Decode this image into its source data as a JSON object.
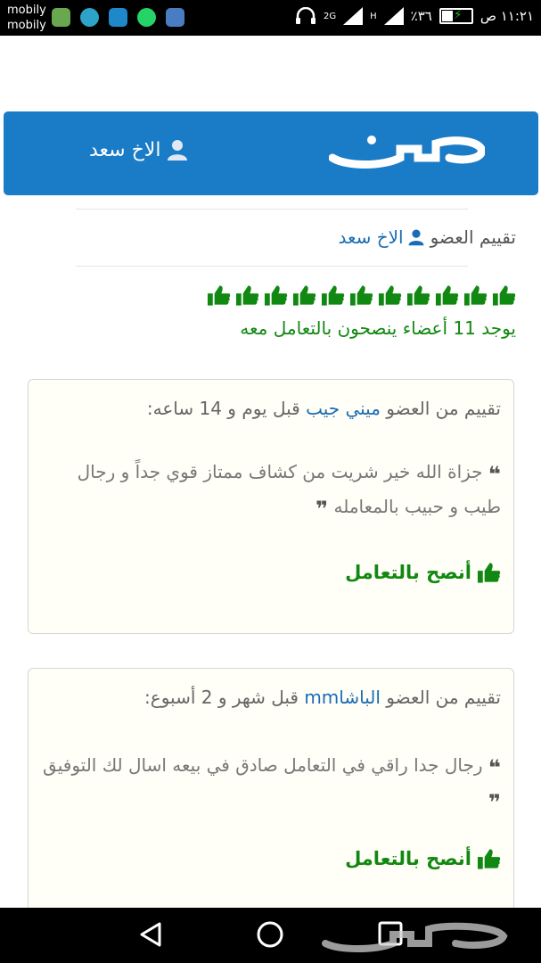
{
  "status_bar": {
    "carrier_line1": "mobily",
    "carrier_line2": "mobily",
    "network": "2G",
    "network2": "H",
    "battery_percent": "٪٣٦",
    "time": "١١:٢١ ص"
  },
  "header": {
    "logo_text": "حراج",
    "user_name": "الاخ سعد"
  },
  "member_rating": {
    "label": "تقييم العضو",
    "member_name": "الاخ سعد",
    "thumbs_count": 11,
    "recommend_text": "يوجد 11 أعضاء ينصحون بالتعامل معه"
  },
  "reviews": [
    {
      "label": "تقييم من العضو",
      "member": "ميني جيب",
      "time": "قبل يوم و 14 ساعه:",
      "text": "جزاة الله خير شريت من كشاف ممتاز قوي جداً و رجال طيب و حبيب بالمعامله",
      "recommend": "أنصح بالتعامل"
    },
    {
      "label": "تقييم من العضو",
      "member": "الباشاmm",
      "time": "قبل شهر و 2 أسبوع:",
      "text": "رجال جدا راقي في التعامل صادق في بيعه اسال لك التوفيق",
      "recommend": "أنصح بالتعامل"
    }
  ],
  "colors": {
    "header_blue": "#1a7bc6",
    "green": "#118811",
    "link_blue": "#1a6db5"
  },
  "icons": [
    "user-icon",
    "thumbs-up-icon",
    "quote-icon",
    "back-icon",
    "home-icon",
    "recent-apps-icon"
  ]
}
